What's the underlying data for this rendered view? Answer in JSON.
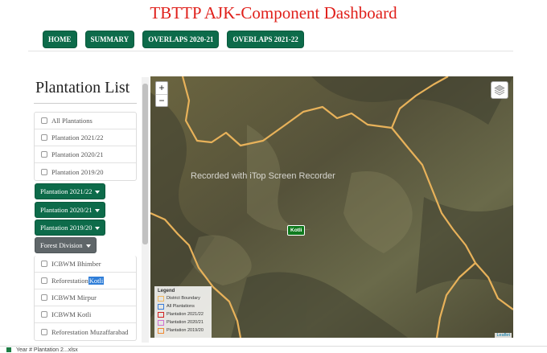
{
  "header": {
    "title": "TBTTP AJK-Component Dashboard"
  },
  "nav": {
    "items": [
      "HOME",
      "SUMMARY",
      "OVERLAPS 2020-21",
      "OVERLAPS 2021-22"
    ]
  },
  "sidebar": {
    "title": "Plantation List",
    "checklist_top": [
      "All Plantations",
      "Plantation 2021/22",
      "Plantation 2020/21",
      "Plantation 2019/20"
    ],
    "dropdowns": [
      "Plantation 2021/22",
      "Plantation 2020/21",
      "Plantation 2019/20"
    ],
    "forest_division": "Forest Division",
    "checklist_bottom": [
      "ICBWM Bhimber",
      "Reforestation",
      "ICBWM Mirpur",
      "ICBWM Kotli",
      "Reforestation Muzaffarabad"
    ],
    "highlight_suffix": "Kotli"
  },
  "map": {
    "zoom_in": "+",
    "zoom_out": "−",
    "watermark": "Recorded with iTop Screen Recorder",
    "marker": "Kotli",
    "attribution": "Leaflet",
    "legend": {
      "title": "Legend",
      "items": [
        {
          "label": "District Boundary",
          "color": "#f0b860"
        },
        {
          "label": "All Plantations",
          "color": "#3b7dd8"
        },
        {
          "label": "Plantation 2021/22",
          "color": "#d22020"
        },
        {
          "label": "Plantation 2020/21",
          "color": "#d070d0"
        },
        {
          "label": "Plantation 2019/20",
          "color": "#f08a30"
        }
      ]
    }
  },
  "download_bar": {
    "file": "Year # Plantation 2...xlsx"
  },
  "colors": {
    "accent": "#0d6b4a",
    "title": "#e0201b",
    "boundary": "#e8b25a"
  }
}
